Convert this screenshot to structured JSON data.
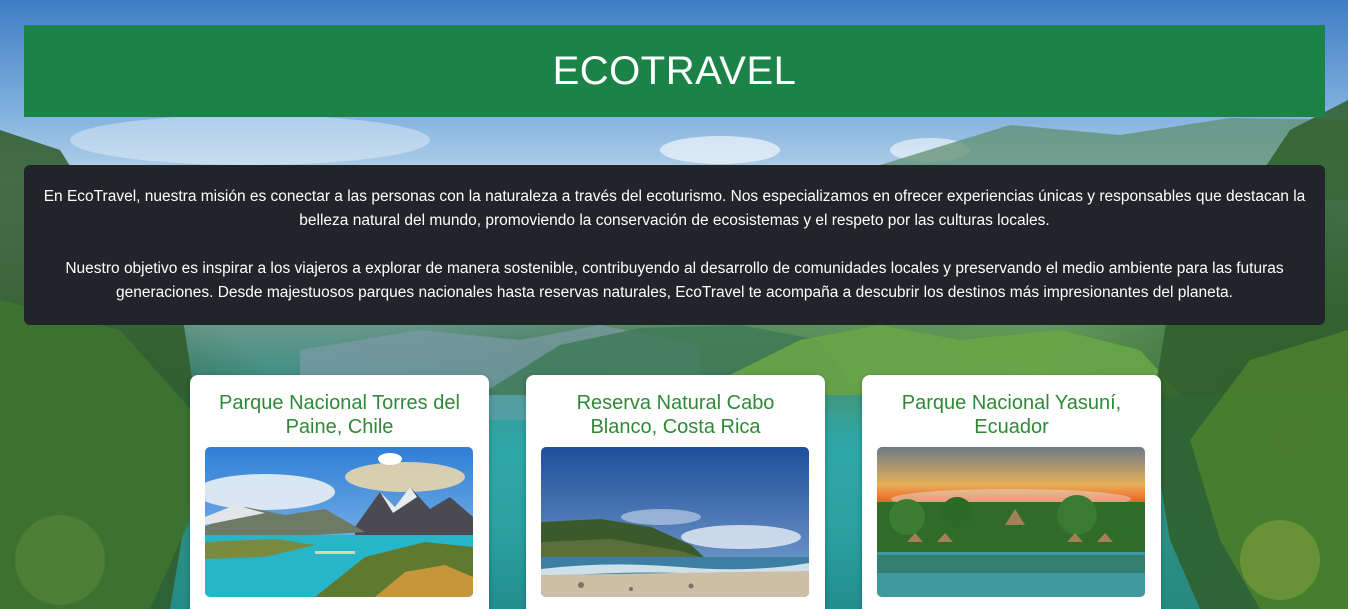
{
  "header": {
    "title": "ECOTRAVEL"
  },
  "mission": {
    "paragraph_1": "En EcoTravel, nuestra misión es conectar a las personas con la naturaleza a través del ecoturismo. Nos especializamos en ofrecer experiencias únicas y responsables que destacan la belleza natural del mundo, promoviendo la conservación de ecosistemas y el respeto por las culturas locales.",
    "paragraph_2": "Nuestro objetivo es inspirar a los viajeros a explorar de manera sostenible, contribuyendo al desarrollo de comunidades locales y preservando el medio ambiente para las futuras generaciones. Desde majestuosos parques nacionales hasta reservas naturales, EcoTravel te acompaña a descubrir los destinos más impresionantes del planeta."
  },
  "destinations": [
    {
      "title": "Parque Nacional Torres del Paine, Chile",
      "image": "torres-del-paine-photo"
    },
    {
      "title": "Reserva Natural Cabo Blanco, Costa Rica",
      "image": "cabo-blanco-photo"
    },
    {
      "title": "Parque Nacional Yasuní, Ecuador",
      "image": "yasuni-photo"
    }
  ],
  "colors": {
    "header_bg": "#1b8348",
    "mission_bg": "#212529",
    "card_title": "#2e8a37"
  }
}
